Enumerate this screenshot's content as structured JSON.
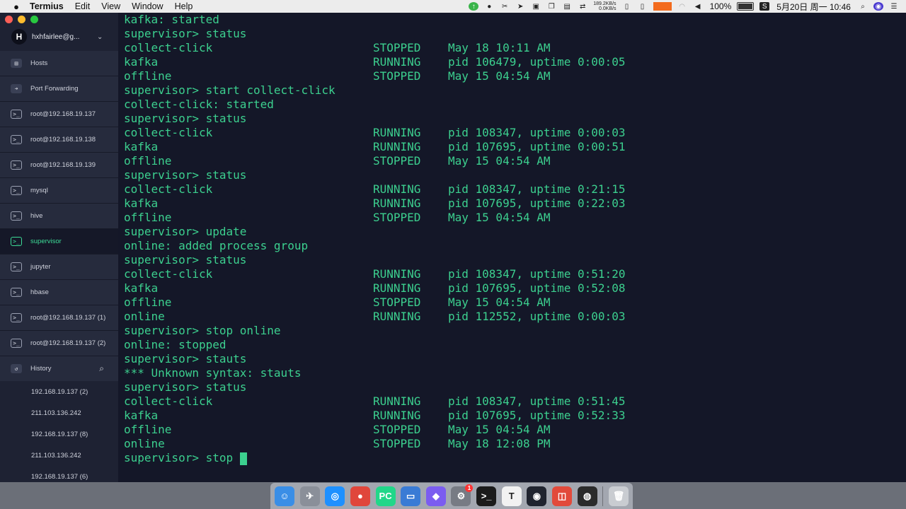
{
  "menubar": {
    "app_name": "Termius",
    "items": [
      "Edit",
      "View",
      "Window",
      "Help"
    ],
    "net_up": "189.2KB/s",
    "net_down": "0.0KB/s",
    "battery": "100%",
    "datetime": "5月20日 周一  10:46"
  },
  "sidebar": {
    "account_initial": "H",
    "account_name": "hxhfairlee@g...",
    "nav": [
      {
        "label": "Hosts",
        "icon": "hosts-icon"
      },
      {
        "label": "Port Forwarding",
        "icon": "port-forwarding-icon"
      },
      {
        "label": "root@192.168.19.137",
        "icon": "terminal-icon"
      },
      {
        "label": "root@192.168.19.138",
        "icon": "terminal-icon"
      },
      {
        "label": "root@192.168.19.139",
        "icon": "terminal-icon"
      },
      {
        "label": "mysql",
        "icon": "terminal-icon"
      },
      {
        "label": "hive",
        "icon": "terminal-icon"
      },
      {
        "label": "supervisor",
        "icon": "terminal-icon",
        "active": true
      },
      {
        "label": "jupyter",
        "icon": "terminal-icon"
      },
      {
        "label": "hbase",
        "icon": "terminal-icon"
      },
      {
        "label": "root@192.168.19.137 (1)",
        "icon": "terminal-icon"
      },
      {
        "label": "root@192.168.19.137 (2)",
        "icon": "terminal-icon"
      }
    ],
    "history_label": "History",
    "history": [
      "192.168.19.137 (2)",
      "211.103.136.242",
      "192.168.19.137 (8)",
      "211.103.136.242",
      "192.168.19.137 (6)"
    ]
  },
  "terminal": {
    "lines": [
      {
        "text": "kafka: started"
      },
      {
        "text": "supervisor> status"
      },
      {
        "name": "collect-click",
        "state": "STOPPED",
        "info": "May 18 10:11 AM"
      },
      {
        "name": "kafka",
        "state": "RUNNING",
        "info": "pid 106479, uptime 0:00:05"
      },
      {
        "name": "offline",
        "state": "STOPPED",
        "info": "May 15 04:54 AM"
      },
      {
        "text": "supervisor> start collect-click"
      },
      {
        "text": "collect-click: started"
      },
      {
        "text": "supervisor> status"
      },
      {
        "name": "collect-click",
        "state": "RUNNING",
        "info": "pid 108347, uptime 0:00:03"
      },
      {
        "name": "kafka",
        "state": "RUNNING",
        "info": "pid 107695, uptime 0:00:51"
      },
      {
        "name": "offline",
        "state": "STOPPED",
        "info": "May 15 04:54 AM"
      },
      {
        "text": "supervisor> status"
      },
      {
        "name": "collect-click",
        "state": "RUNNING",
        "info": "pid 108347, uptime 0:21:15"
      },
      {
        "name": "kafka",
        "state": "RUNNING",
        "info": "pid 107695, uptime 0:22:03"
      },
      {
        "name": "offline",
        "state": "STOPPED",
        "info": "May 15 04:54 AM"
      },
      {
        "text": "supervisor> update"
      },
      {
        "text": "online: added process group"
      },
      {
        "text": "supervisor> status"
      },
      {
        "name": "collect-click",
        "state": "RUNNING",
        "info": "pid 108347, uptime 0:51:20"
      },
      {
        "name": "kafka",
        "state": "RUNNING",
        "info": "pid 107695, uptime 0:52:08"
      },
      {
        "name": "offline",
        "state": "STOPPED",
        "info": "May 15 04:54 AM"
      },
      {
        "name": "online",
        "state": "RUNNING",
        "info": "pid 112552, uptime 0:00:03"
      },
      {
        "text": "supervisor> stop online"
      },
      {
        "text": "online: stopped"
      },
      {
        "text": "supervisor> stauts"
      },
      {
        "text": "*** Unknown syntax: stauts"
      },
      {
        "text": "supervisor> status"
      },
      {
        "name": "collect-click",
        "state": "RUNNING",
        "info": "pid 108347, uptime 0:51:45"
      },
      {
        "name": "kafka",
        "state": "RUNNING",
        "info": "pid 107695, uptime 0:52:33"
      },
      {
        "name": "offline",
        "state": "STOPPED",
        "info": "May 15 04:54 AM"
      },
      {
        "name": "online",
        "state": "STOPPED",
        "info": "May 18 12:08 PM"
      }
    ],
    "prompt": "supervisor> stop "
  },
  "dock": {
    "apps": [
      {
        "name": "finder-icon",
        "glyph": "☺",
        "color": "#3a8ee6"
      },
      {
        "name": "launchpad-icon",
        "glyph": "✈",
        "color": "#8a8f99"
      },
      {
        "name": "safari-icon",
        "glyph": "◎",
        "color": "#1e90ff"
      },
      {
        "name": "chrome-icon",
        "glyph": "●",
        "color": "#e0463b"
      },
      {
        "name": "pycharm-icon",
        "glyph": "PC",
        "color": "#21d789"
      },
      {
        "name": "keynote-icon",
        "glyph": "▭",
        "color": "#3a7bd5"
      },
      {
        "name": "vpn-icon",
        "glyph": "◆",
        "color": "#7b5cf0"
      },
      {
        "name": "system-preferences-icon",
        "glyph": "⚙",
        "color": "#777b84",
        "badge": "1"
      },
      {
        "name": "terminal-app-icon",
        "glyph": ">_",
        "color": "#1b1b1b"
      },
      {
        "name": "typora-icon",
        "glyph": "T",
        "color": "#f2f2f2"
      },
      {
        "name": "termius-dock-icon",
        "glyph": "◉",
        "color": "#20242f"
      },
      {
        "name": "parallels-icon",
        "glyph": "◫",
        "color": "#e24a3b"
      },
      {
        "name": "obs-icon",
        "glyph": "◍",
        "color": "#2b2b2b"
      },
      {
        "name": "trash-icon",
        "glyph": "🗑",
        "color": "#c9ccd1"
      }
    ]
  }
}
